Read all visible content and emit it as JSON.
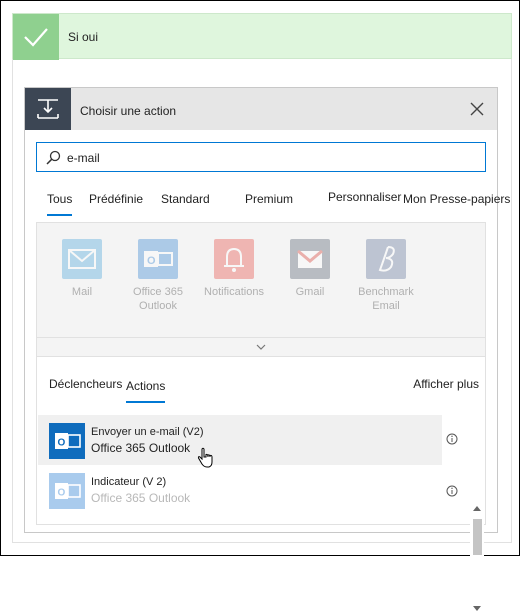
{
  "condition": {
    "label": "Si oui",
    "color": "#8fd08f"
  },
  "action": {
    "title": "Choisir une action",
    "search": {
      "value": "e-mail",
      "placeholder": ""
    },
    "tabs": [
      {
        "label": "Tous",
        "active": true
      },
      {
        "label": "Prédéfinie"
      },
      {
        "label": "Standard"
      },
      {
        "label": "Premium"
      },
      {
        "label": "Personnaliser"
      },
      {
        "label": "Mon Presse-papiers"
      }
    ],
    "connectors": [
      {
        "name": "Mail",
        "icon": "mail-icon",
        "color": "#3fa0d8"
      },
      {
        "name": "Office 365 Outlook",
        "icon": "outlook-icon",
        "color": "#2a7fd0"
      },
      {
        "name": "Notifications",
        "icon": "bell-icon",
        "color": "#e8423a"
      },
      {
        "name": "Gmail",
        "icon": "gmail-icon",
        "color": "#4a5766"
      },
      {
        "name": "Benchmark Email",
        "icon": "benchmark-icon",
        "color": "#5a6e95"
      }
    ],
    "subtabs": [
      {
        "label": "Déclencheurs"
      },
      {
        "label": "Actions",
        "active": true
      }
    ],
    "show_more": "Afficher plus",
    "results": [
      {
        "title": "Envoyer un e-mail (V2)",
        "connector": "Office 365 Outlook",
        "highlighted": true
      },
      {
        "title": "Indicateur (V 2)",
        "connector": "Office 365 Outlook",
        "faded": true
      }
    ]
  }
}
